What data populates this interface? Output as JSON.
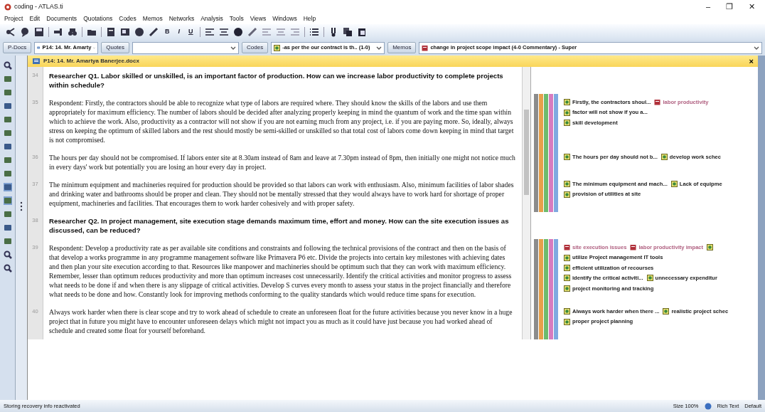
{
  "window": {
    "title": "coding - ATLAS.ti",
    "controls": [
      "–",
      "❐",
      "✕"
    ]
  },
  "menu": [
    "Project",
    "Edit",
    "Documents",
    "Quotations",
    "Codes",
    "Memos",
    "Networks",
    "Analysis",
    "Tools",
    "Views",
    "Windows",
    "Help"
  ],
  "toolbar": {
    "format_buttons": [
      "B",
      "I",
      "U"
    ]
  },
  "selector_bar": [
    {
      "button": "P-Docs",
      "value": "P14: 14. Mr. Amarty"
    },
    {
      "button": "Quotes"
    },
    {
      "button": "Codes",
      "value": "-as per the our contract is th.. (1-0)"
    },
    {
      "button": "Memos",
      "value": "change in project scope impact (4-0 Commentary) - Super"
    }
  ],
  "document": {
    "title": "P14: 14. Mr. Amartya Banerjee.docx",
    "close": "×",
    "paragraphs": [
      {
        "number": "34",
        "kind": "question",
        "text": "Researcher Q1. Labor skilled or unskilled, is an important factor of production. How can we increase labor productivity to complete projects within schedule?",
        "bars": false
      },
      {
        "number": "35",
        "kind": "answer",
        "text": "Respondent: Firstly, the contractors should be able to recognize what type of labors are required where. They should know the skills of the labors and use them appropriately for maximum efficiency. The number of labors should be decided after analyzing properly keeping in mind the quantum of work and the time span within which to achieve the work. Also, productivity as a contractor will not show if you are not earning much from any project, i.e. if you are paying more. So, ideally, always stress on keeping the optimum of skilled labors and the rest should mostly be semi-skilled or unskilled so that total cost of labors come down keeping in mind that target is not compromised.",
        "bars": true,
        "margin": [
          [
            {
              "kind": "code",
              "label": "Firstly, the contractors shoul..."
            },
            {
              "kind": "memo",
              "label": "labor productivity"
            }
          ],
          [
            {
              "kind": "code",
              "label": "factor will not show if you a..."
            }
          ],
          [
            {
              "kind": "code",
              "label": "skill development"
            }
          ]
        ]
      },
      {
        "number": "36",
        "kind": "answer",
        "text": "The hours per day should not be compromised. If labors enter site at 8.30am instead of 8am and leave at 7.30pm instead of 8pm, then initially one might not notice much in every days' work but potentially you are losing an hour every day in project.",
        "bars": true,
        "margin": [
          [
            {
              "kind": "code",
              "label": "The hours per day should not b..."
            },
            {
              "kind": "code",
              "label": "develop work schec"
            }
          ]
        ]
      },
      {
        "number": "37",
        "kind": "answer",
        "text": "The minimum equipment and machineries required for production should be provided so that labors can work with enthusiasm. Also, minimum facilities of labor shades and drinking water and bathrooms should be proper and clean. They should not be mentally stressed that they would always have to work hard for shortage of proper equipment, machineries and facilities. That encourages them to work harder cohesively and with proper safety.",
        "bars": true,
        "margin": [
          [
            {
              "kind": "code",
              "label": "The minimum equipment and mach..."
            },
            {
              "kind": "code",
              "label": "Lack of equipme"
            }
          ],
          [
            {
              "kind": "code",
              "label": "provision of utilities at site"
            }
          ]
        ]
      },
      {
        "number": "38",
        "kind": "question",
        "text": "Researcher Q2. In project management, site execution stage demands maximum time, effort and money. How can the site execution issues as discussed, can be reduced?",
        "bars": false
      },
      {
        "number": "39",
        "kind": "answer",
        "text": "Respondent: Develop a productivity rate as per available site conditions and constraints and following the technical provisions of the contract and then on the basis of that develop a works programme in any programme management software like Primavera P6 etc. Divide the projects into certain key milestones with achieving dates and then plan your site execution according to that. Resources like manpower and machineries should be optimum such that they can work with maximum efficiency. Remember, lesser than optimum reduces productivity and more than optimum increases cost unnecessarily. Identify the critical activities and monitor progress to assess what needs to be done if and when there is any slippage of critical activities. Develop S curves every month to assess your status in the project financially and therefore what needs to be done and how. Constantly look for improving methods conforming to the quality standards which would reduce time spans for execution.",
        "bars": true,
        "margin": [
          [
            {
              "kind": "memo",
              "label": "site execution issues"
            },
            {
              "kind": "memo",
              "label": "labor productivity impact"
            },
            {
              "kind": "code"
            }
          ],
          [
            {
              "kind": "code",
              "label": "utilize Project management IT tools"
            }
          ],
          [
            {
              "kind": "code",
              "label": "efficient utilization of recourses"
            }
          ],
          [
            {
              "kind": "code",
              "label": "identify the critical activiti..."
            },
            {
              "kind": "code",
              "label": "unnecessary expenditur"
            }
          ],
          [
            {
              "kind": "code",
              "label": "project monitoring and tracking"
            }
          ]
        ]
      },
      {
        "number": "40",
        "kind": "answer",
        "text": "Always work harder when there is clear scope and try to work ahead of schedule to create an unforeseen float for the future activities because you never know in a huge project that in future you might have to encounter unforeseen delays which might not impact you as much as it could have just because you had worked ahead of schedule and created some float for yourself beforehand.",
        "bars": true,
        "margin": [
          [
            {
              "kind": "code",
              "label": "Always work harder when there ..."
            },
            {
              "kind": "code",
              "label": "realistic project schec"
            }
          ],
          [
            {
              "kind": "code",
              "label": "proper project planning"
            }
          ]
        ]
      }
    ]
  },
  "status_bar": {
    "message": "Storing recovery info reactivated",
    "zoom": "Size 100%",
    "format": "Rich Text",
    "style": "Default"
  }
}
